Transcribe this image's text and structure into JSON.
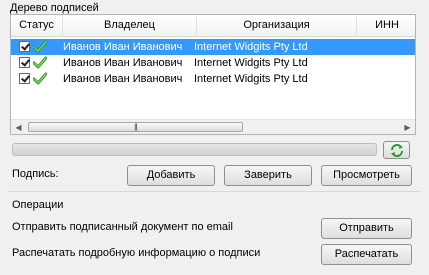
{
  "tree": {
    "title": "Дерево подписей",
    "columns": [
      "Статус",
      "Владелец",
      "Организация",
      "ИНН"
    ],
    "rows": [
      {
        "owner": "Иванов Иван Иванович",
        "org": "Internet Widgits Pty Ltd",
        "inn": "",
        "checked": true,
        "selected": true
      },
      {
        "owner": "Иванов Иван Иванович",
        "org": "Internet Widgits Pty Ltd",
        "inn": "",
        "checked": true,
        "selected": false
      },
      {
        "owner": "Иванов Иван Иванович",
        "org": "Internet Widgits Pty Ltd",
        "inn": "",
        "checked": true,
        "selected": false
      }
    ]
  },
  "signature": {
    "label": "Подпись:",
    "add_button": "Добавить",
    "certify_button": "Заверить",
    "view_button": "Просмотреть"
  },
  "operations": {
    "title": "Операции",
    "email_label": "Отправить подписанный документ по email",
    "send_button": "Отправить",
    "print_label": "Распечатать подробную информацию о подписи",
    "print_button": "Распечатать"
  },
  "colors": {
    "selection": "#3399ff",
    "check_green": "#3aa52c"
  },
  "icons": {
    "row_status": "green-checkmark-icon",
    "refresh": "refresh-arrows-icon"
  }
}
